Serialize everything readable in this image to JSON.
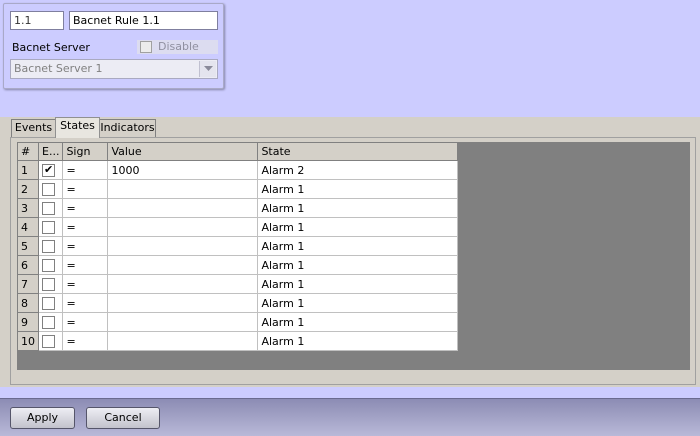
{
  "rule": {
    "id": "1.1",
    "name": "Bacnet Rule 1.1",
    "server_label": "Bacnet Server",
    "disable_label": "Disable",
    "server_value": "Bacnet Server 1"
  },
  "tabs": [
    {
      "label": "Events"
    },
    {
      "label": "States"
    },
    {
      "label": "Indicators"
    }
  ],
  "grid": {
    "columns": [
      "#",
      "E...",
      "Sign",
      "Value",
      "State"
    ],
    "rows": [
      {
        "num": "1",
        "enabled": true,
        "sign": "=",
        "value": "1000",
        "state": "Alarm 2"
      },
      {
        "num": "2",
        "enabled": false,
        "sign": "=",
        "value": "",
        "state": "Alarm 1"
      },
      {
        "num": "3",
        "enabled": false,
        "sign": "=",
        "value": "",
        "state": "Alarm 1"
      },
      {
        "num": "4",
        "enabled": false,
        "sign": "=",
        "value": "",
        "state": "Alarm 1"
      },
      {
        "num": "5",
        "enabled": false,
        "sign": "=",
        "value": "",
        "state": "Alarm 1"
      },
      {
        "num": "6",
        "enabled": false,
        "sign": "=",
        "value": "",
        "state": "Alarm 1"
      },
      {
        "num": "7",
        "enabled": false,
        "sign": "=",
        "value": "",
        "state": "Alarm 1"
      },
      {
        "num": "8",
        "enabled": false,
        "sign": "=",
        "value": "",
        "state": "Alarm 1"
      },
      {
        "num": "9",
        "enabled": false,
        "sign": "=",
        "value": "",
        "state": "Alarm 1"
      },
      {
        "num": "10",
        "enabled": false,
        "sign": "=",
        "value": "",
        "state": "Alarm 1"
      }
    ]
  },
  "buttons": {
    "apply": "Apply",
    "cancel": "Cancel"
  },
  "colors": {
    "background": "#ccccff",
    "grid_empty": "#808080"
  },
  "icons": {
    "dropdown": "chevron-down-icon",
    "checkbox": "checkbox-icon"
  }
}
